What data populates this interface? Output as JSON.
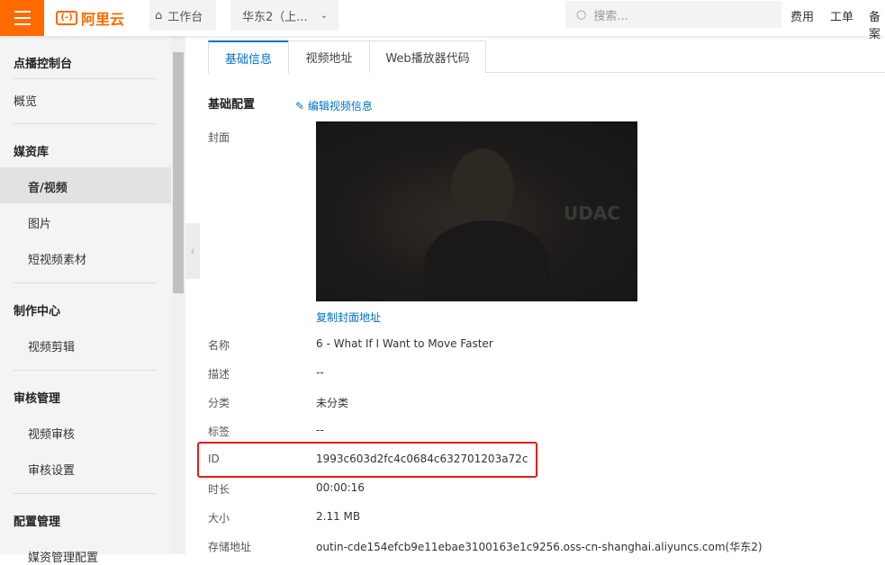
{
  "header": {
    "logo": "阿里云",
    "workbench": "工作台",
    "region": "华东2（上...",
    "search_placeholder": "搜索...",
    "links": [
      "费用",
      "工单",
      "备案"
    ]
  },
  "sidebar": {
    "title": "点播控制台",
    "items": [
      {
        "label": "概览",
        "type": "top"
      },
      {
        "label": "媒资库",
        "type": "group"
      },
      {
        "label": "音/视频",
        "type": "item",
        "selected": true
      },
      {
        "label": "图片",
        "type": "item"
      },
      {
        "label": "短视频素材",
        "type": "item"
      },
      {
        "label": "制作中心",
        "type": "group"
      },
      {
        "label": "视频剪辑",
        "type": "item"
      },
      {
        "label": "审核管理",
        "type": "group"
      },
      {
        "label": "视频审核",
        "type": "item"
      },
      {
        "label": "审核设置",
        "type": "item"
      },
      {
        "label": "配置管理",
        "type": "group"
      },
      {
        "label": "媒资管理配置",
        "type": "item"
      }
    ]
  },
  "tabs": [
    {
      "label": "基础信息",
      "active": true
    },
    {
      "label": "视频地址"
    },
    {
      "label": "Web播放器代码"
    }
  ],
  "section": {
    "title": "基础配置",
    "edit_label": "编辑视频信息",
    "cover_label": "封面",
    "copy_cover": "复制封面地址"
  },
  "fields": [
    {
      "label": "名称",
      "value": "6 - What If I Want to Move Faster"
    },
    {
      "label": "描述",
      "value": "--"
    },
    {
      "label": "分类",
      "value": "未分类"
    },
    {
      "label": "标签",
      "value": "--"
    },
    {
      "label": "ID",
      "value": "1993c603d2fc4c0684c632701203a72c",
      "highlighted": true
    },
    {
      "label": "时长",
      "value": "00:00:16"
    },
    {
      "label": "大小",
      "value": "2.11 MB"
    },
    {
      "label": "存储地址",
      "value": "outin-cde154efcb9e11ebae3100163e1c9256.oss-cn-shanghai.aliyuncs.com(华东2)"
    }
  ],
  "colors": {
    "brand": "#ff6a00",
    "accent": "#0070cc",
    "highlight": "#e81919"
  }
}
